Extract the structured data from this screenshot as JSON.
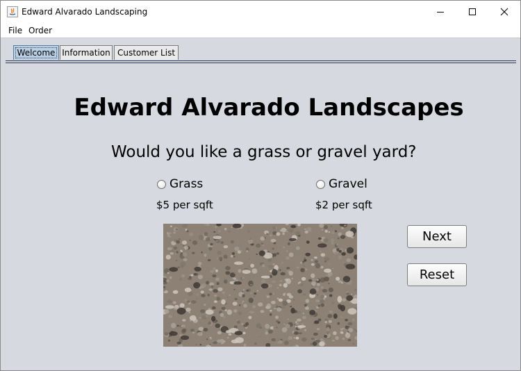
{
  "window": {
    "title": "Edward Alvarado Landscaping"
  },
  "menu": {
    "file": "File",
    "order": "Order"
  },
  "tabs": [
    {
      "label": "Welcome",
      "selected": true
    },
    {
      "label": "Information",
      "selected": false
    },
    {
      "label": "Customer List",
      "selected": false
    }
  ],
  "main": {
    "heading": "Edward Alvarado Landscapes",
    "question": "Would you like a grass or gravel yard?",
    "options": [
      {
        "label": "Grass",
        "price": "$5 per sqft",
        "checked": false
      },
      {
        "label": "Gravel",
        "price": "$2 per sqft",
        "checked": false
      }
    ],
    "image": {
      "subject": "gravel-ground-photo"
    },
    "buttons": {
      "next": "Next",
      "reset": "Reset"
    }
  },
  "colors": {
    "background": "#d6d9df",
    "tab_selected": "#b8cfe5"
  }
}
